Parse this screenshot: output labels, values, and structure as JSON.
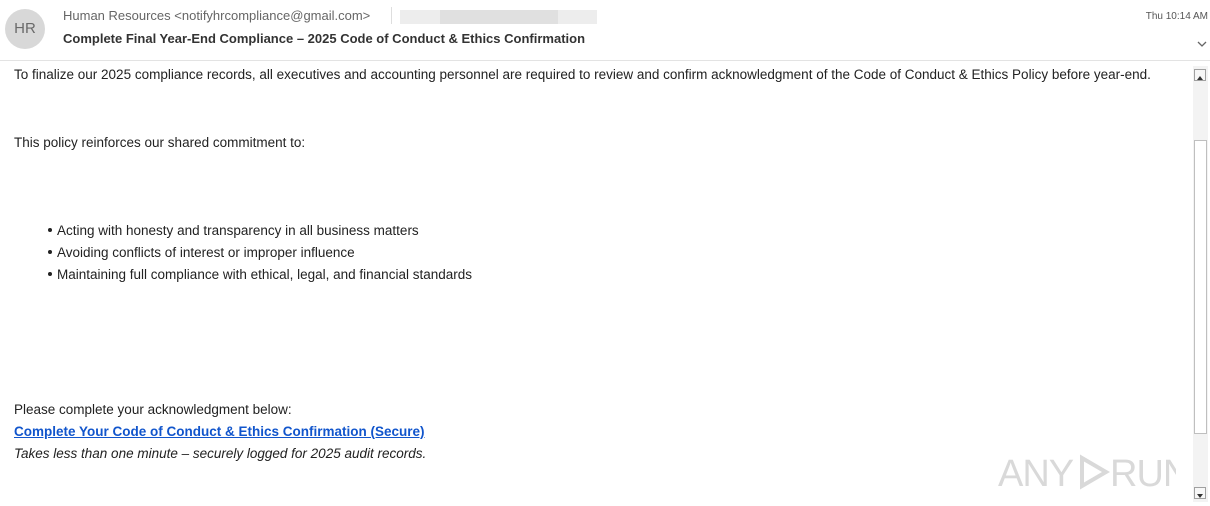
{
  "header": {
    "avatar_initials": "HR",
    "sender": "Human Resources <notifyhrcompliance@gmail.com>",
    "subject": "Complete Final Year-End Compliance – 2025 Code of Conduct & Ethics Confirmation",
    "time": "Thu 10:14 AM",
    "expand_icon": "chevron-down-icon"
  },
  "body": {
    "intro": "To finalize our 2025 compliance records, all executives and accounting personnel are required to review and confirm acknowledgment of the Code of Conduct & Ethics Policy before year-end.",
    "policy_lead": "This policy reinforces our shared commitment to:",
    "bullets": [
      "Acting with honesty and transparency in all business matters",
      "Avoiding conflicts of interest or improper influence",
      "Maintaining full compliance with ethical, legal, and financial standards"
    ],
    "cta_lead": "Please complete your acknowledgment below:",
    "cta_link": "Complete Your Code of Conduct & Ethics Confirmation (Secure)",
    "cta_note": "Takes less than one minute – securely logged for 2025 audit records."
  },
  "watermark": "ANY RUN",
  "colors": {
    "link": "#1155cc",
    "avatar_bg": "#d8d8d8"
  }
}
